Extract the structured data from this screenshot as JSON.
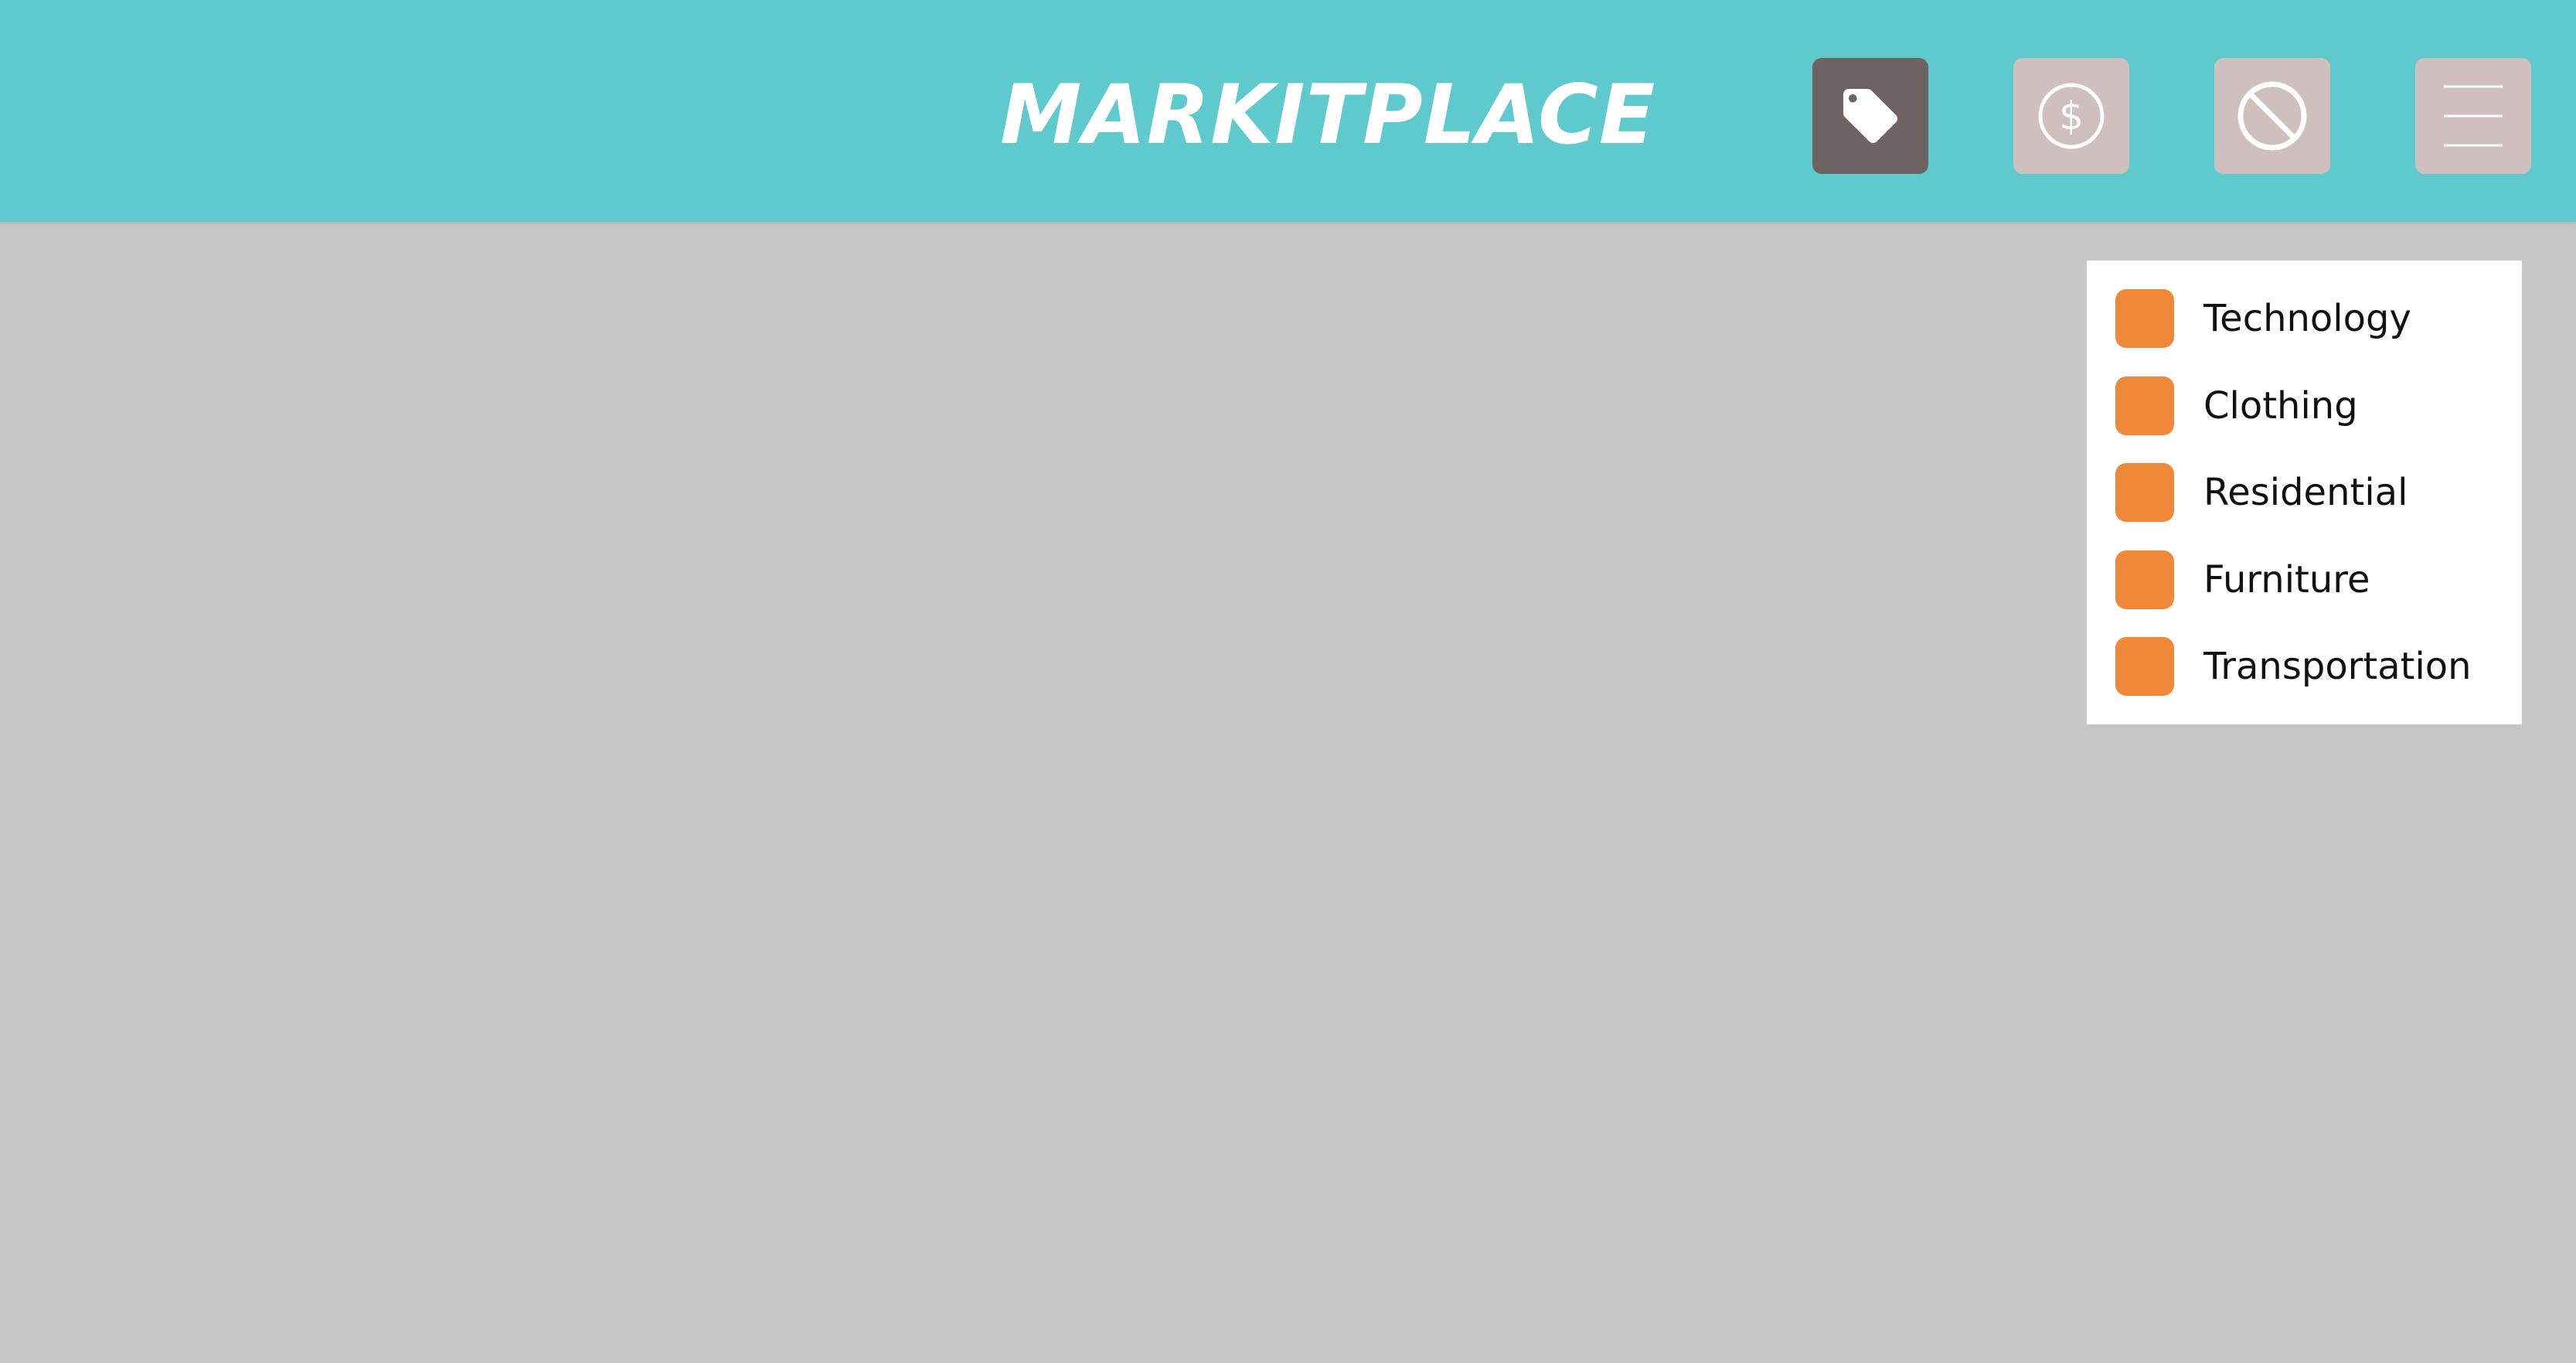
{
  "header": {
    "title": "MARKITPLACE",
    "background_color": "#5ecacd",
    "buttons": [
      {
        "icon": "tag-icon",
        "active": true
      },
      {
        "icon": "dollar-circle-icon",
        "active": false
      },
      {
        "icon": "no-entry-icon",
        "active": false
      },
      {
        "icon": "hamburger-menu-icon",
        "active": false
      }
    ]
  },
  "filters": {
    "checkbox_color": "#f0883a",
    "items": [
      {
        "label": "Technology"
      },
      {
        "label": "Clothing"
      },
      {
        "label": "Residential"
      },
      {
        "label": "Furniture"
      },
      {
        "label": "Transportation"
      }
    ]
  },
  "colors": {
    "page_background": "#c6c6c6",
    "button_active": "#6e6262",
    "button_inactive": "#cfbfbf"
  }
}
